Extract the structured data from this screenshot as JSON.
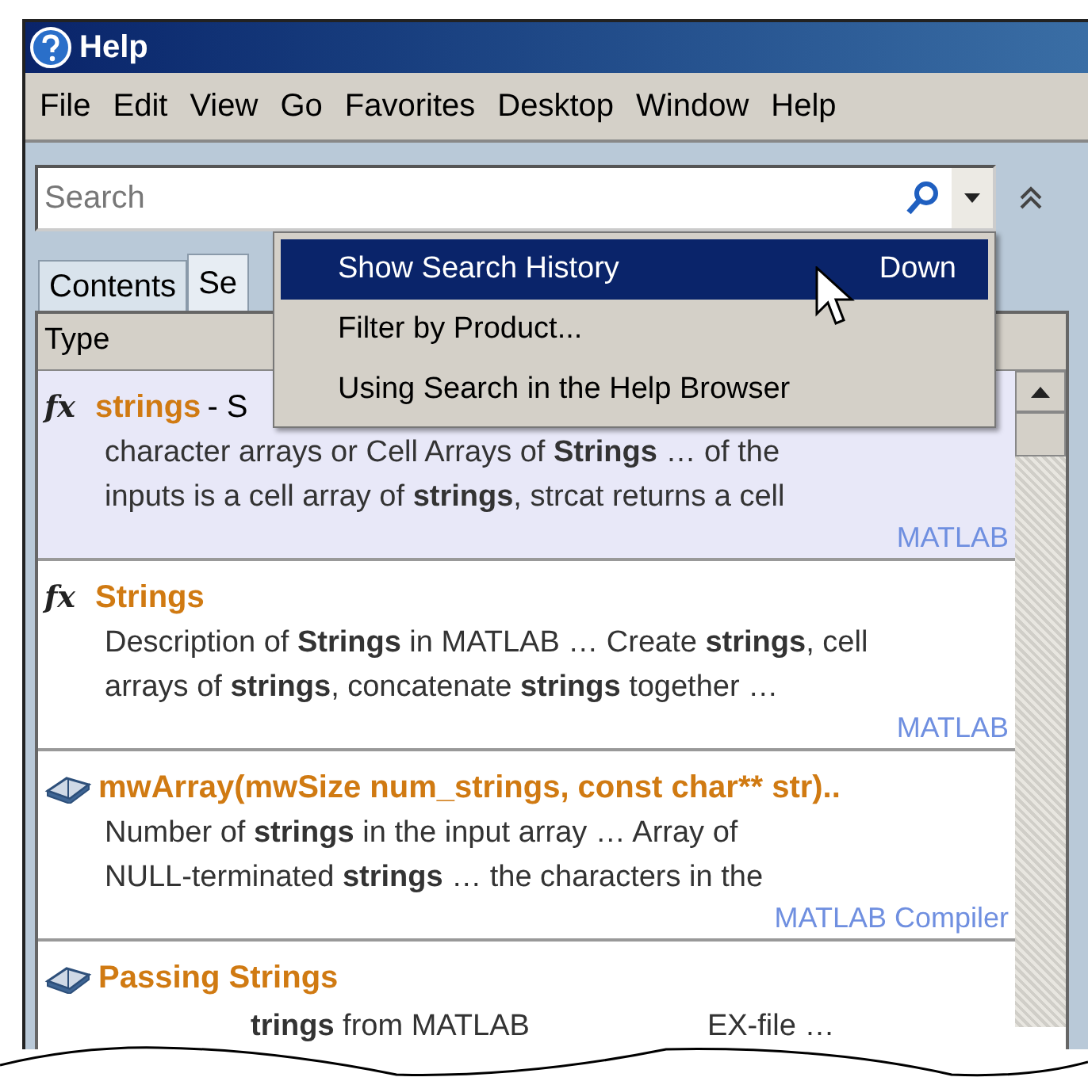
{
  "window": {
    "title": "Help"
  },
  "menu": [
    "File",
    "Edit",
    "View",
    "Go",
    "Favorites",
    "Desktop",
    "Window",
    "Help"
  ],
  "search": {
    "placeholder": "Search"
  },
  "tabs": [
    {
      "label": "Contents",
      "selected": false
    },
    {
      "label": "Se",
      "selected": true
    }
  ],
  "popup_menu": [
    {
      "label": "Show Search History",
      "shortcut": "Down",
      "selected": true
    },
    {
      "label": "Filter by Product...",
      "selected": false
    },
    {
      "label": "Using Search in the Help Browser",
      "selected": false
    }
  ],
  "table": {
    "columns": [
      "Type"
    ],
    "results": [
      {
        "kind": "function",
        "icon": "fx",
        "title": "strings",
        "title_suffix": "- S",
        "selected": true,
        "description": [
          "character arrays or Cell Arrays of **Strings** … of the",
          "inputs is a cell array of **strings**, strcat returns a cell"
        ],
        "product": "MATLAB"
      },
      {
        "kind": "function",
        "icon": "fx",
        "title": "Strings",
        "selected": false,
        "description": [
          "Description of **Strings** in MATLAB … Create **strings**, cell",
          "arrays of **strings**, concatenate **strings** together …"
        ],
        "product": "MATLAB"
      },
      {
        "kind": "book",
        "title": "mwArray(mwSize num_strings, const char** str)..",
        "selected": false,
        "description": [
          "Number of **strings** in the input array … Array of",
          "NULL-terminated **strings** … the characters in the"
        ],
        "product": "MATLAB Compiler"
      },
      {
        "kind": "book",
        "title": "Passing Strings",
        "selected": false,
        "fragments": [
          "**trings** from MATLAB",
          "EX-file …"
        ]
      }
    ]
  }
}
